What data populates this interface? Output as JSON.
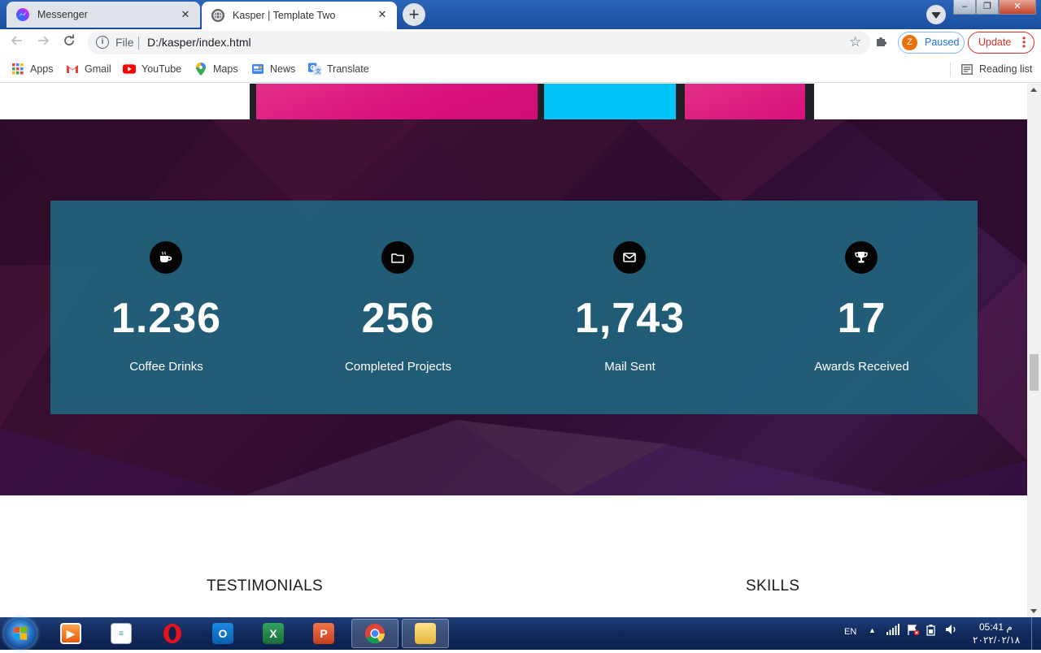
{
  "browser": {
    "tabs": [
      {
        "title": "Messenger",
        "active": false
      },
      {
        "title": "Kasper | Template Two",
        "active": true
      }
    ],
    "new_tab_symbol": "+",
    "window_controls": {
      "minimize": "–",
      "restore": "❐",
      "close": "✕"
    },
    "omnibox": {
      "scheme_label": "File",
      "url": "D:/kasper/index.html"
    },
    "profile": {
      "initial": "Z",
      "status": "Paused"
    },
    "update_label": "Update",
    "bookmarks": [
      {
        "label": "Apps",
        "icon": "apps-grid-icon"
      },
      {
        "label": "Gmail",
        "icon": "gmail-icon"
      },
      {
        "label": "YouTube",
        "icon": "youtube-icon"
      },
      {
        "label": "Maps",
        "icon": "maps-icon"
      },
      {
        "label": "News",
        "icon": "news-icon"
      },
      {
        "label": "Translate",
        "icon": "translate-icon"
      }
    ],
    "reading_list_label": "Reading list"
  },
  "page": {
    "stats": [
      {
        "icon": "coffee-icon",
        "value": "1.236",
        "label": "Coffee Drinks"
      },
      {
        "icon": "folder-icon",
        "value": "256",
        "label": "Completed Projects"
      },
      {
        "icon": "envelope-icon",
        "value": "1,743",
        "label": "Mail Sent"
      },
      {
        "icon": "trophy-icon",
        "value": "17",
        "label": "Awards Received"
      }
    ],
    "headings": {
      "testimonials": "TESTIMONIALS",
      "skills": "SKILLS"
    },
    "colors": {
      "stats_box": "#1f6880",
      "band": "#3c0f33",
      "tile_pink": "#e0187f",
      "tile_cyan": "#00c2f5"
    }
  },
  "taskbar": {
    "apps": [
      "media-player-icon",
      "notepad-icon",
      "opera-icon",
      "outlook-icon",
      "excel-icon",
      "powerpoint-icon",
      "chrome-icon",
      "file-explorer-icon"
    ],
    "language": "EN",
    "time": "05:41 م",
    "date": "٢٠٢٢/٠٢/١٨"
  }
}
